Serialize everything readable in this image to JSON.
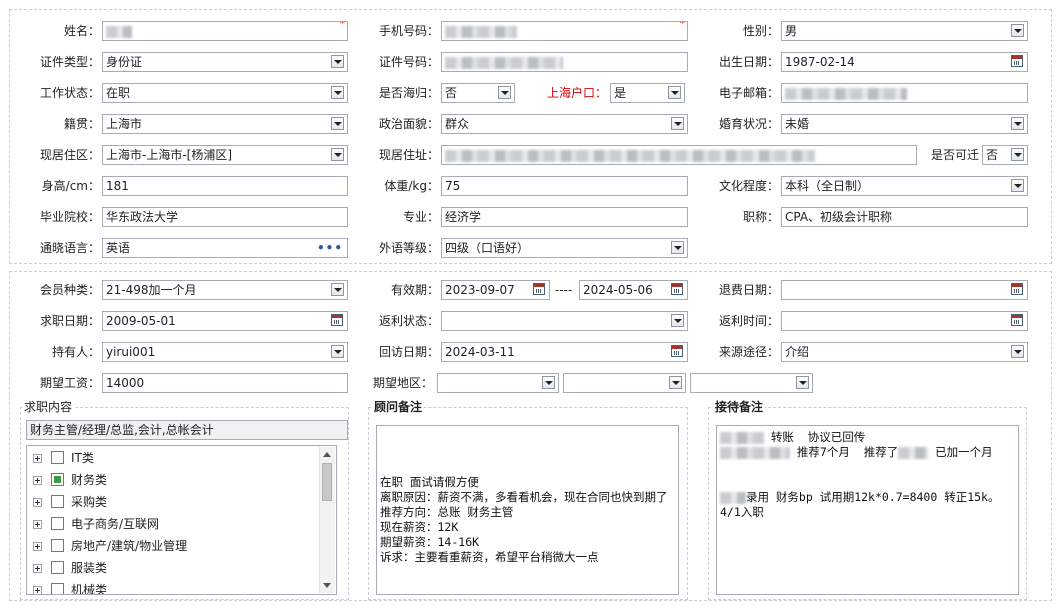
{
  "personal": {
    "name_label": "姓名：",
    "name_required": "*",
    "phone_label": "手机号码：",
    "phone_required": "*",
    "gender_label": "性别：",
    "gender_value": "男",
    "id_type_label": "证件类型：",
    "id_type_value": "身份证",
    "id_number_label": "证件号码：",
    "birth_label": "出生日期：",
    "birth_value": "1987-02-14",
    "work_status_label": "工作状态：",
    "work_status_value": "在职",
    "returnee_label": "是否海归：",
    "returnee_value": "否",
    "hukou_label": "上海户口：",
    "hukou_value": "是",
    "email_label": "电子邮箱：",
    "native_label": "籍贯：",
    "native_value": "上海市",
    "political_label": "政治面貌：",
    "political_value": "群众",
    "marital_label": "婚育状况：",
    "marital_value": "未婚",
    "residence_area_label": "现居住区：",
    "residence_area_value": "上海市-上海市-[杨浦区]",
    "address_label": "现居住址：",
    "visitable_label": "是否可迁",
    "visitable_value": "否",
    "height_label": "身高/cm：",
    "height_value": "181",
    "weight_label": "体重/kg：",
    "weight_value": "75",
    "education_label": "文化程度：",
    "education_value": "本科（全日制）",
    "school_label": "毕业院校：",
    "school_value": "华东政法大学",
    "major_label": "专业：",
    "major_value": "经济学",
    "title_label": "职称：",
    "title_value": "CPA、初级会计职称",
    "language_label": "通晓语言：",
    "language_value": "英语",
    "language_more": "•••",
    "foreign_level_label": "外语等级：",
    "foreign_level_value": "四级（口语好）"
  },
  "membership": {
    "type_label": "会员种类：",
    "type_value": "21-498加一个月",
    "valid_label": "有效期：",
    "valid_from": "2023-09-07",
    "valid_sep": "----",
    "valid_to": "2024-05-06",
    "refund_label": "退费日期：",
    "job_date_label": "求职日期：",
    "job_date_value": "2009-05-01",
    "rebate_status_label": "返利状态：",
    "rebate_time_label": "返利时间：",
    "holder_label": "持有人：",
    "holder_value": "yirui001",
    "callback_label": "回访日期：",
    "callback_value": "2024-03-11",
    "source_label": "来源途径：",
    "source_value": "介绍",
    "salary_label": "期望工资：",
    "salary_value": "14000",
    "region_label": "期望地区："
  },
  "job_content": {
    "title": "求职内容",
    "selected": "财务主管/经理/总监,会计,总帐会计",
    "tree": [
      {
        "label": "IT类",
        "checked": false
      },
      {
        "label": "财务类",
        "checked": true
      },
      {
        "label": "采购类",
        "checked": false
      },
      {
        "label": "电子商务/互联网",
        "checked": false
      },
      {
        "label": "房地产/建筑/物业管理",
        "checked": false
      },
      {
        "label": "服装类",
        "checked": false
      },
      {
        "label": "机械类",
        "checked": false
      }
    ]
  },
  "consultant_notes": {
    "title": "顾问备注",
    "text": "\n\n\n在职 面试请假方便\n离职原因：薪资不满，多看看机会，现在合同也快到期了\n推荐方向：总账 财务主管\n现在薪资：12K\n期望薪资：14-16K\n诉求：主要看重薪资，希望平台稍微大一点"
  },
  "reception_notes": {
    "title": "接待备注",
    "line1": " 转账  协议已回传",
    "line2a": " 推荐7个月  推荐了",
    "line2b": " 已加一个月",
    "line3": "录用 财务bp 试用期12k*0.7=8400 转正15k。4/1入职"
  },
  "colors": {
    "required": "#d40000",
    "border": "#a5acb5",
    "check_green": "#3d9a3d"
  }
}
